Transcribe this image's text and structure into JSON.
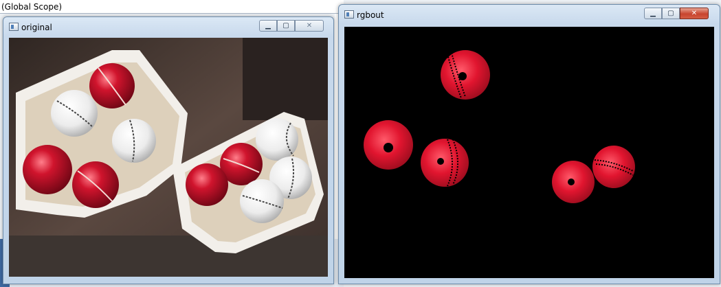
{
  "scope_bar": {
    "label": "(Global Scope)"
  },
  "windows": {
    "original": {
      "title": "original"
    },
    "rgbout": {
      "title": "rgbout"
    }
  },
  "controls": {
    "minimize": "▁",
    "maximize": "▢",
    "close": "✕"
  },
  "colors": {
    "titlebar": "#c8d9ec",
    "ball_red": "#c8102e",
    "ball_white": "#f4f4f4",
    "tray": "#e6d6c0",
    "table": "#4a3a33",
    "black": "#000000"
  }
}
